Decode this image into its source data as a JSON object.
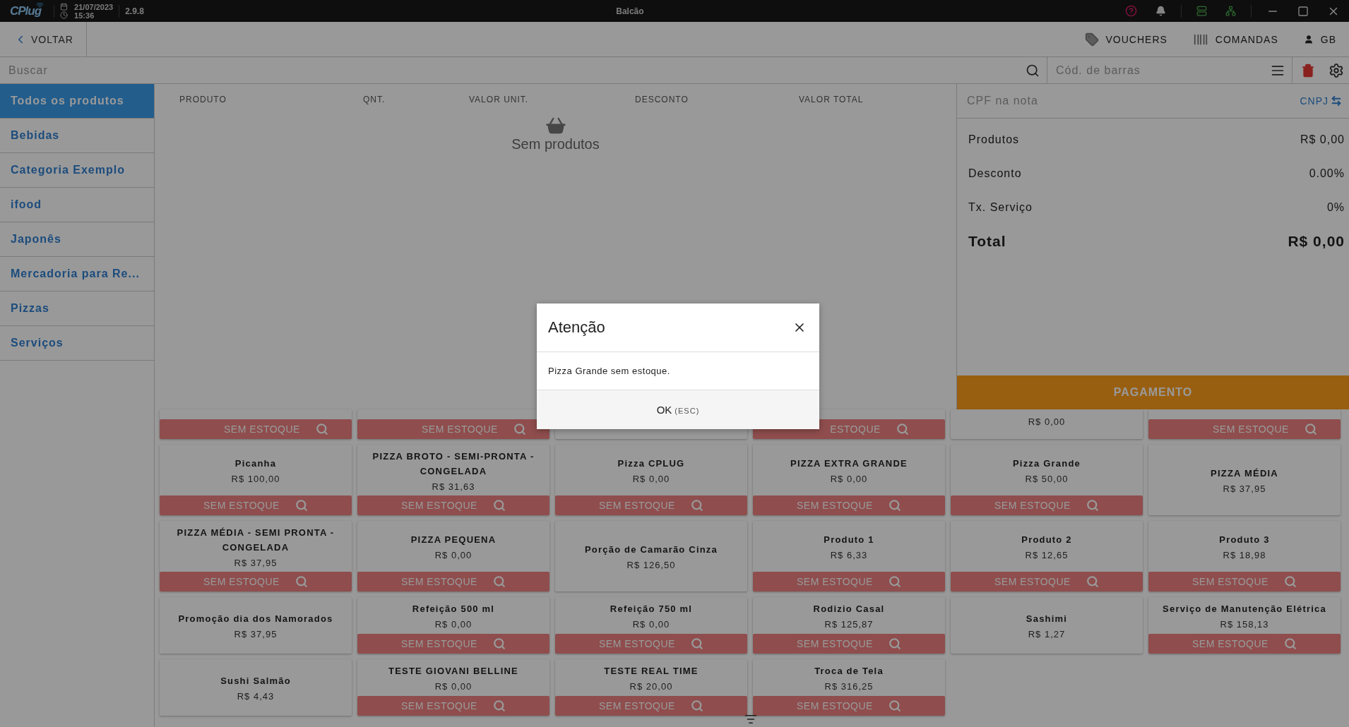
{
  "titlebar": {
    "logo": "CPlug",
    "date": "21/07/2023",
    "time": "15:36",
    "version": "2.9.8",
    "title": "Balcão"
  },
  "toolbar": {
    "back": "VOLTAR",
    "actions": [
      {
        "kind": "voucher",
        "label": "VOUCHERS"
      },
      {
        "kind": "orders",
        "label": "COMANDAS"
      },
      {
        "kind": "user",
        "label": "GB"
      }
    ]
  },
  "search": {
    "placeholder": "Buscar"
  },
  "barcode": {
    "placeholder": "Cód. de barras"
  },
  "categories": [
    {
      "label": "Todos os produtos",
      "selected": true
    },
    {
      "label": "Bebidas",
      "selected": false
    },
    {
      "label": "Categoria Exemplo",
      "selected": false
    },
    {
      "label": "ifood",
      "selected": false
    },
    {
      "label": "Japonês",
      "selected": false
    },
    {
      "label": "Mercadoria para Re...",
      "selected": false
    },
    {
      "label": "Pizzas",
      "selected": false
    },
    {
      "label": "Serviços",
      "selected": false
    }
  ],
  "cart": {
    "columns": [
      "PRODUTO",
      "QNT.",
      "VALOR UNIT.",
      "DESCONTO",
      "VALOR TOTAL"
    ],
    "empty_text": "Sem produtos"
  },
  "summary": {
    "cpf_placeholder": "CPF na nota",
    "toggle": "CNPJ",
    "rows": [
      {
        "kind": "line",
        "label": "Produtos",
        "value": "R$ 0,00"
      },
      {
        "kind": "line",
        "label": "Desconto",
        "value": "0.00%"
      },
      {
        "kind": "line",
        "label": "Tx. Serviço",
        "value": "0%"
      },
      {
        "kind": "total",
        "label": "Total",
        "value": "R$ 0,00"
      }
    ],
    "pay_button": "PAGAMENTO"
  },
  "products": [
    {
      "kind": "partial",
      "status": "SEM ESTOQUE"
    },
    {
      "kind": "partial",
      "status": "SEM ESTOQUE"
    },
    {
      "kind": "partial"
    },
    {
      "kind": "partial",
      "status": "ESTOQUE"
    },
    {
      "kind": "partial",
      "price": "R$ 0,00"
    },
    {
      "kind": "partial",
      "status": "SEM ESTOQUE"
    },
    {
      "kind": "full",
      "name": "Picanha",
      "price": "R$ 100,00",
      "status": "SEM ESTOQUE"
    },
    {
      "kind": "full",
      "name": "PIZZA BROTO - SEMI-PRONTA - CONGELADA",
      "price": "R$ 31,63",
      "status": "SEM ESTOQUE"
    },
    {
      "kind": "full",
      "name": "Pizza CPLUG",
      "price": "R$ 0,00",
      "status": "SEM ESTOQUE"
    },
    {
      "kind": "full",
      "name": "PIZZA EXTRA GRANDE",
      "price": "R$ 0,00",
      "status": "SEM ESTOQUE"
    },
    {
      "kind": "full",
      "name": "Pizza Grande",
      "price": "R$ 50,00",
      "status": "SEM ESTOQUE"
    },
    {
      "kind": "full",
      "name": "PIZZA MÉDIA",
      "price": "R$ 37,95"
    },
    {
      "kind": "full",
      "name": "PIZZA MÉDIA - SEMI PRONTA - CONGELADA",
      "price": "R$ 37,95",
      "status": "SEM ESTOQUE"
    },
    {
      "kind": "full",
      "name": "PIZZA PEQUENA",
      "price": "R$ 0,00",
      "status": "SEM ESTOQUE"
    },
    {
      "kind": "full",
      "name": "Porção de Camarão Cinza",
      "price": "R$ 126,50"
    },
    {
      "kind": "full",
      "name": "Produto 1",
      "price": "R$ 6,33",
      "status": "SEM ESTOQUE"
    },
    {
      "kind": "full",
      "name": "Produto 2",
      "price": "R$ 12,65",
      "status": "SEM ESTOQUE"
    },
    {
      "kind": "full",
      "name": "Produto 3",
      "price": "R$ 18,98",
      "status": "SEM ESTOQUE"
    },
    {
      "kind": "full",
      "name": "Promoção dia dos Namorados",
      "price": "R$ 37,95"
    },
    {
      "kind": "full",
      "name": "Refeição 500 ml",
      "price": "R$ 0,00",
      "status": "SEM ESTOQUE"
    },
    {
      "kind": "full",
      "name": "Refeição 750 ml",
      "price": "R$ 0,00",
      "status": "SEM ESTOQUE"
    },
    {
      "kind": "full",
      "name": "Rodizio Casal",
      "price": "R$ 125,87",
      "status": "SEM ESTOQUE"
    },
    {
      "kind": "full",
      "name": "Sashimi",
      "price": "R$ 1,27"
    },
    {
      "kind": "full",
      "name": "Serviço de Manutenção Elétrica",
      "price": "R$ 158,13",
      "status": "SEM ESTOQUE"
    },
    {
      "kind": "full",
      "name": "Sushi Salmão",
      "price": "R$ 4,43"
    },
    {
      "kind": "full",
      "name": "TESTE GIOVANI BELLINE",
      "price": "R$ 0,00",
      "status": "SEM ESTOQUE"
    },
    {
      "kind": "full",
      "name": "TESTE REAL TIME",
      "price": "R$ 20,00",
      "status": "SEM ESTOQUE"
    },
    {
      "kind": "full",
      "name": "Troca de Tela",
      "price": "R$ 316,25",
      "status": "SEM ESTOQUE"
    }
  ],
  "dialog": {
    "title": "Atenção",
    "message": "Pizza Grande sem estoque.",
    "ok": "OK",
    "shortcut": "(ESC)"
  }
}
